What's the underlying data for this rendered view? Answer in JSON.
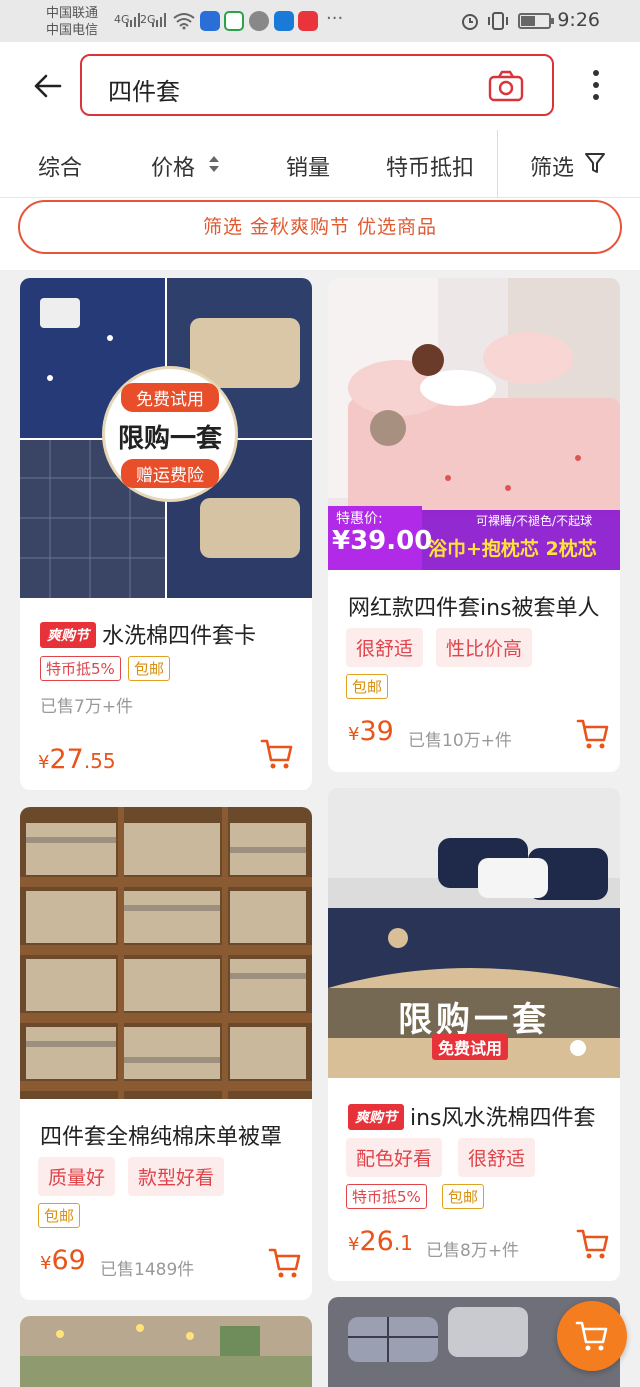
{
  "status_bar": {
    "carrier1": "中国联通",
    "carrier2": "中国电信",
    "net1": "4G",
    "net2": "2G",
    "time": "9:26"
  },
  "search": {
    "query": "四件套",
    "camera_icon": "camera-icon",
    "back_icon": "back-arrow-icon",
    "more_icon": "more-vertical-icon"
  },
  "sort_tabs": [
    {
      "label": "综合"
    },
    {
      "label": "价格"
    },
    {
      "label": "销量"
    },
    {
      "label": "特币抵扣"
    },
    {
      "label": "筛选"
    }
  ],
  "promo_filter": "筛选 金秋爽购节 优选商品",
  "colors": {
    "accent": "#e8541a",
    "search_border": "#d9343a",
    "tag_red": "#e0444b"
  },
  "products": [
    {
      "festival_badge": "爽购节",
      "title": "水洗棉四件套卡",
      "tags_outline": [
        "特币抵5%",
        "包邮"
      ],
      "sold": "已售7万+件",
      "price_currency": "¥",
      "price_int": "27",
      "price_dec": ".55",
      "overlay": {
        "top": "免费试用",
        "middle": "限购一套",
        "bottom": "赠运费险"
      }
    },
    {
      "title": "网红款四件套ins被套单人",
      "tags_solid": [
        "很舒适",
        "性比价高"
      ],
      "tags_outline": [
        "包邮"
      ],
      "sold": "已售10万+件",
      "price_currency": "¥",
      "price_int": "39",
      "price_dec": "",
      "overlay": {
        "label": "特惠价:",
        "price": "¥39.00",
        "right_top": "可裸睡/不褪色/不起球",
        "right_bottom": "浴巾+抱枕芯 2枕芯"
      }
    },
    {
      "title": "四件套全棉纯棉床单被罩",
      "tags_solid": [
        "质量好",
        "款型好看"
      ],
      "tags_outline": [
        "包邮"
      ],
      "sold": "已售1489件",
      "price_currency": "¥",
      "price_int": "69",
      "price_dec": ""
    },
    {
      "festival_badge": "爽购节",
      "title": "ins风水洗棉四件套",
      "tags_solid": [
        "配色好看",
        "很舒适"
      ],
      "tags_outline": [
        "特币抵5%",
        "包邮"
      ],
      "sold": "已售8万+件",
      "price_currency": "¥",
      "price_int": "26",
      "price_dec": ".1",
      "overlay": {
        "main": "限购一套",
        "sub": "免费试用"
      }
    }
  ]
}
